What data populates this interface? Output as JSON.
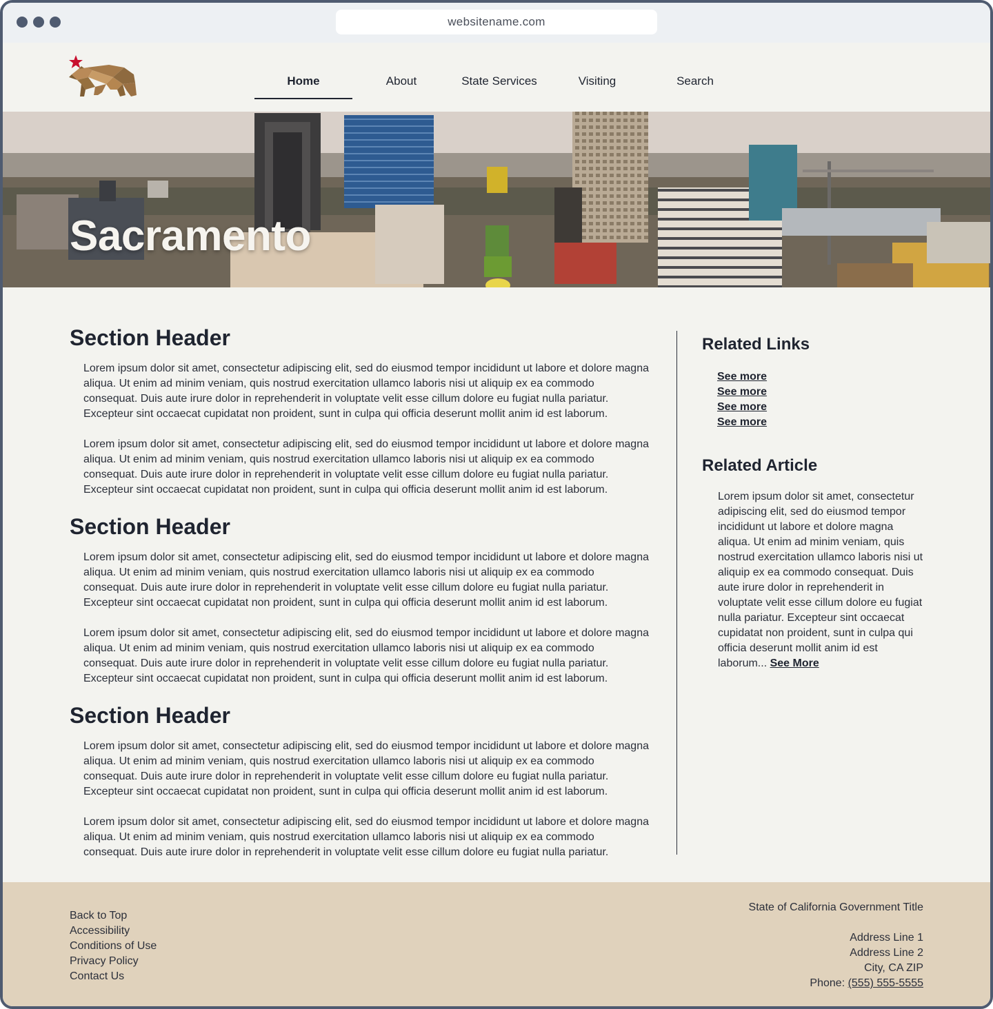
{
  "browser": {
    "url": "websitename.com"
  },
  "header": {
    "logo_icon": "california-bear-icon",
    "nav": [
      {
        "label": "Home",
        "active": true
      },
      {
        "label": "About",
        "active": false
      },
      {
        "label": "State Services",
        "active": false
      },
      {
        "label": "Visiting",
        "active": false
      },
      {
        "label": "Search",
        "active": false
      }
    ]
  },
  "hero": {
    "title": "Sacramento"
  },
  "main": {
    "sections": [
      {
        "header": "Section Header",
        "paragraphs": [
          "Lorem ipsum dolor sit amet, consectetur adipiscing elit, sed do eiusmod tempor incididunt ut labore et dolore magna aliqua. Ut enim ad minim veniam, quis nostrud exercitation ullamco laboris nisi ut aliquip ex ea commodo consequat. Duis aute irure dolor in reprehenderit in voluptate velit esse cillum dolore eu fugiat nulla pariatur. Excepteur sint occaecat cupidatat non proident, sunt in culpa qui officia deserunt mollit anim id est laborum.",
          "Lorem ipsum dolor sit amet, consectetur adipiscing elit, sed do eiusmod tempor incididunt ut labore et dolore magna aliqua. Ut enim ad minim veniam, quis nostrud exercitation ullamco laboris nisi ut aliquip ex ea commodo consequat. Duis aute irure dolor in reprehenderit in voluptate velit esse cillum dolore eu fugiat nulla pariatur. Excepteur sint occaecat cupidatat non proident, sunt in culpa qui officia deserunt mollit anim id est laborum."
        ]
      },
      {
        "header": "Section Header",
        "paragraphs": [
          "Lorem ipsum dolor sit amet, consectetur adipiscing elit, sed do eiusmod tempor incididunt ut labore et dolore magna aliqua. Ut enim ad minim veniam, quis nostrud exercitation ullamco laboris nisi ut aliquip ex ea commodo consequat. Duis aute irure dolor in reprehenderit in voluptate velit esse cillum dolore eu fugiat nulla pariatur. Excepteur sint occaecat cupidatat non proident, sunt in culpa qui officia deserunt mollit anim id est laborum.",
          "Lorem ipsum dolor sit amet, consectetur adipiscing elit, sed do eiusmod tempor incididunt ut labore et dolore magna aliqua. Ut enim ad minim veniam, quis nostrud exercitation ullamco laboris nisi ut aliquip ex ea commodo consequat. Duis aute irure dolor in reprehenderit in voluptate velit esse cillum dolore eu fugiat nulla pariatur. Excepteur sint occaecat cupidatat non proident, sunt in culpa qui officia deserunt mollit anim id est laborum."
        ]
      },
      {
        "header": "Section Header",
        "paragraphs": [
          "Lorem ipsum dolor sit amet, consectetur adipiscing elit, sed do eiusmod tempor incididunt ut labore et dolore magna aliqua. Ut enim ad minim veniam, quis nostrud exercitation ullamco laboris nisi ut aliquip ex ea commodo consequat. Duis aute irure dolor in reprehenderit in voluptate velit esse cillum dolore eu fugiat nulla pariatur. Excepteur sint occaecat cupidatat non proident, sunt in culpa qui officia deserunt mollit anim id est laborum.",
          "Lorem ipsum dolor sit amet, consectetur adipiscing elit, sed do eiusmod tempor incididunt ut labore et dolore magna aliqua. Ut enim ad minim veniam, quis nostrud exercitation ullamco laboris nisi ut aliquip ex ea commodo consequat. Duis aute irure dolor in reprehenderit in voluptate velit esse cillum dolore eu fugiat nulla pariatur."
        ]
      }
    ]
  },
  "aside": {
    "related_links_title": "Related Links",
    "links": [
      "See more",
      "See more",
      "See more",
      "See more"
    ],
    "related_article_title": "Related Article",
    "article_text": "Lorem ipsum dolor sit amet, consectetur adipiscing elit, sed do eiusmod tempor incididunt ut labore et dolore magna aliqua. Ut enim ad minim veniam, quis nostrud exercitation ullamco laboris nisi ut aliquip ex ea commodo consequat. Duis aute irure dolor in reprehenderit in voluptate velit esse cillum dolore eu fugiat nulla pariatur. Excepteur sint occaecat cupidatat non proident, sunt in culpa qui officia deserunt mollit anim id est laborum...",
    "article_link": "See More"
  },
  "footer": {
    "links": [
      "Back to Top",
      "Accessibility",
      "Conditions of Use",
      "Privacy Policy",
      "Contact Us"
    ],
    "org_title": "State of California Government Title",
    "address_line_1": "Address Line 1",
    "address_line_2": "Address Line 2",
    "city_line": "City, CA ZIP",
    "phone_label": "Phone: ",
    "phone": "(555) 555-5555"
  },
  "colors": {
    "page_bg": "#f3f3ef",
    "footer_bg": "#e0d2bc",
    "frame": "#4f5b70",
    "text": "#2b2f3a",
    "star": "#c8102e",
    "bear": "#a57a4a"
  }
}
